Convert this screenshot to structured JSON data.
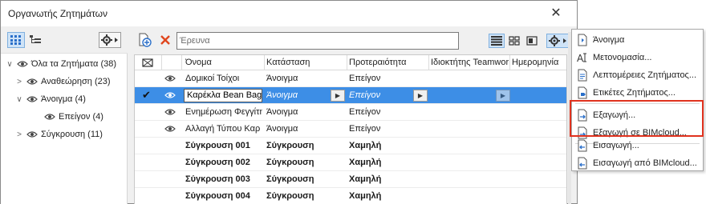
{
  "window": {
    "title": "Οργανωτής Ζητημάτων",
    "close": "✕"
  },
  "left_tree": {
    "items": [
      {
        "label": "Όλα τα Ζητήματα (38)",
        "chevron": "∨",
        "indent": 0
      },
      {
        "label": "Αναθεώρηση (23)",
        "chevron": ">",
        "indent": 1
      },
      {
        "label": "Άνοιγμα (4)",
        "chevron": "∨",
        "indent": 1
      },
      {
        "label": "Επείγον (4)",
        "chevron": "",
        "indent": 2
      },
      {
        "label": "Σύγκρουση (11)",
        "chevron": ">",
        "indent": 1
      }
    ]
  },
  "toolbar": {
    "search_placeholder": "Έρευνα"
  },
  "grid": {
    "headers": [
      "Όνομα",
      "Κατάσταση",
      "Προτεραιότητα",
      "Ιδιοκτήτης Teamwork",
      "Ημερομηνία"
    ],
    "rows": [
      {
        "name": "Δομικοί Τοίχοι",
        "status": "Άνοιγμα",
        "priority": "Επείγον",
        "style": "normal"
      },
      {
        "name": "Καρέκλα Bean Bag",
        "status": "Άνοιγμα",
        "priority": "Επείγον",
        "style": "selected"
      },
      {
        "name": "Ενημέρωση Φεγγίτη",
        "status": "Άνοιγμα",
        "priority": "Επείγον",
        "style": "normal"
      },
      {
        "name": "Αλλαγή Τύπου Καρ",
        "status": "Άνοιγμα",
        "priority": "Επείγον",
        "style": "normal"
      },
      {
        "name": "Σύγκρουση 001",
        "status": "Σύγκρουση",
        "priority": "Χαμηλή",
        "style": "bold"
      },
      {
        "name": "Σύγκρουση 002",
        "status": "Σύγκρουση",
        "priority": "Χαμηλή",
        "style": "bold"
      },
      {
        "name": "Σύγκρουση 003",
        "status": "Σύγκρουση",
        "priority": "Χαμηλή",
        "style": "bold"
      },
      {
        "name": "Σύγκρουση 004",
        "status": "Σύγκρουση",
        "priority": "Χαμηλή",
        "style": "bold"
      }
    ]
  },
  "context_menu": {
    "items": [
      {
        "label": "Άνοιγμα",
        "icon": "open-icon"
      },
      {
        "label": "Μετονομασία...",
        "icon": "rename-icon"
      },
      {
        "label": "Λεπτομέρειες Ζητήματος...",
        "icon": "details-icon"
      },
      {
        "label": "Ετικέτες Ζητήματος...",
        "icon": "tags-icon"
      },
      {
        "label": "Εξαγωγή...",
        "icon": "export-icon"
      },
      {
        "label": "Εξαγωγή σε BIMcloud...",
        "icon": "export-cloud-icon"
      },
      {
        "label": "Εισαγωγή...",
        "icon": "import-icon"
      },
      {
        "label": "Εισαγωγή από BIMcloud...",
        "icon": "import-cloud-icon"
      }
    ]
  },
  "colors": {
    "selection": "#3d8ee6",
    "highlight": "#e0321e",
    "accent_blue": "#2a6fc9"
  }
}
